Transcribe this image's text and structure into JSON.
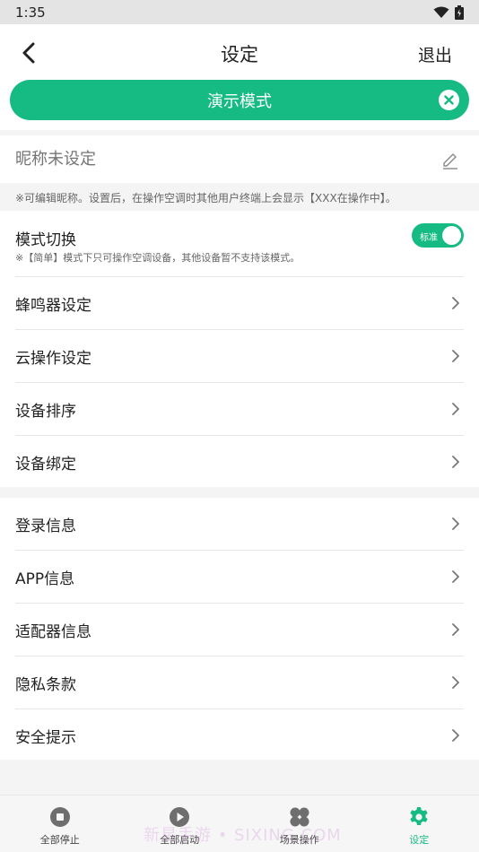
{
  "status_bar": {
    "time": "1:35"
  },
  "header": {
    "title": "设定",
    "logout_label": "退出"
  },
  "demo_banner": {
    "label": "演示模式"
  },
  "nickname": {
    "placeholder": "昵称未设定",
    "hint": "※可编辑昵称。设置后，在操作空调时其他用户终端上会显示【XXX在操作中】。"
  },
  "mode_switch": {
    "label": "模式切换",
    "description": "※【简单】模式下只可操作空调设备，其他设备暂不支持该模式。",
    "toggle_text": "标准",
    "toggle_on": true
  },
  "section_1_items": [
    {
      "label": "蜂鸣器设定"
    },
    {
      "label": "云操作设定"
    },
    {
      "label": "设备排序"
    },
    {
      "label": "设备绑定"
    }
  ],
  "section_2_items": [
    {
      "label": "登录信息"
    },
    {
      "label": "APP信息"
    },
    {
      "label": "适配器信息"
    },
    {
      "label": "隐私条款"
    },
    {
      "label": "安全提示"
    }
  ],
  "tab_bar": {
    "tabs": [
      {
        "label": "全部停止",
        "icon": "stop-circle-icon"
      },
      {
        "label": "全部启动",
        "icon": "play-circle-icon"
      },
      {
        "label": "场景操作",
        "icon": "clover-icon"
      },
      {
        "label": "设定",
        "icon": "gear-icon"
      }
    ],
    "active_index": 3
  },
  "watermark": {
    "text": "新星手游 • SIXING.COM"
  },
  "colors": {
    "accent": "#16bb84",
    "background": "#f4f4f4"
  }
}
